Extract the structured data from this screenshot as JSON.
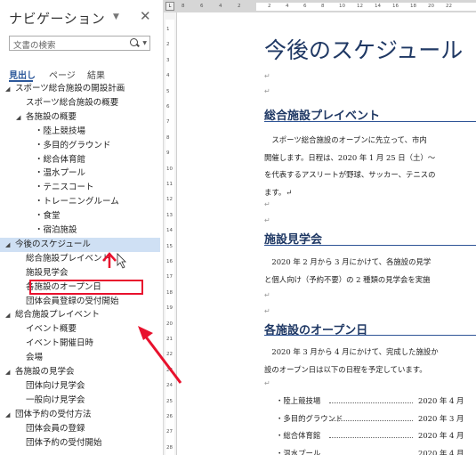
{
  "nav": {
    "title": "ナビゲーション",
    "menu_glyph": "▼",
    "close_glyph": "✕",
    "search_placeholder": "文書の検索",
    "tabs": [
      "見出し",
      "ページ",
      "結果"
    ],
    "tree": [
      {
        "label": "スポーツ総合施設の開設計画",
        "level": 1,
        "collapsible": true
      },
      {
        "label": "スポーツ総合施設の概要",
        "level": 2,
        "collapsible": false
      },
      {
        "label": "各施設の概要",
        "level": 2,
        "collapsible": true
      },
      {
        "label": "・陸上競技場",
        "level": 3,
        "collapsible": false
      },
      {
        "label": "・多目的グラウンド",
        "level": 3,
        "collapsible": false
      },
      {
        "label": "・総合体育館",
        "level": 3,
        "collapsible": false
      },
      {
        "label": "・温水プール",
        "level": 3,
        "collapsible": false
      },
      {
        "label": "・テニスコート",
        "level": 3,
        "collapsible": false
      },
      {
        "label": "・トレーニングルーム",
        "level": 3,
        "collapsible": false
      },
      {
        "label": "・食堂",
        "level": 3,
        "collapsible": false
      },
      {
        "label": "・宿泊施設",
        "level": 3,
        "collapsible": false
      },
      {
        "label": "今後のスケジュール",
        "level": 1,
        "collapsible": true,
        "selected": true
      },
      {
        "label": "総合施設プレイベント",
        "level": 2,
        "collapsible": false
      },
      {
        "label": "施設見学会",
        "level": 2,
        "collapsible": false
      },
      {
        "label": "各施設のオープン日",
        "level": 2,
        "collapsible": false,
        "highlighted": true
      },
      {
        "label": "団体会員登録の受付開始",
        "level": 2,
        "collapsible": false
      },
      {
        "label": "総合施設プレイベント",
        "level": 1,
        "collapsible": true
      },
      {
        "label": "イベント概要",
        "level": 2,
        "collapsible": false
      },
      {
        "label": "イベント開催日時",
        "level": 2,
        "collapsible": false
      },
      {
        "label": "会場",
        "level": 2,
        "collapsible": false
      },
      {
        "label": "各施設の見学会",
        "level": 1,
        "collapsible": true
      },
      {
        "label": "団体向け見学会",
        "level": 2,
        "collapsible": false
      },
      {
        "label": "一般向け見学会",
        "level": 2,
        "collapsible": false
      },
      {
        "label": "団体予約の受付方法",
        "level": 1,
        "collapsible": true
      },
      {
        "label": "団体会員の登録",
        "level": 2,
        "collapsible": false
      },
      {
        "label": "団体予約の受付開始",
        "level": 2,
        "collapsible": false
      }
    ]
  },
  "ruler": {
    "h_left": [
      "8",
      "6",
      "4",
      "2"
    ],
    "h_right": [
      "2",
      "4",
      "6",
      "8",
      "10",
      "12",
      "14",
      "16",
      "18",
      "20",
      "22"
    ],
    "v": [
      "1",
      "2",
      "3",
      "4",
      "5",
      "6",
      "7",
      "8",
      "9",
      "10",
      "11",
      "12",
      "13",
      "14",
      "15",
      "16",
      "17",
      "18",
      "19",
      "20",
      "21",
      "22",
      "23",
      "24",
      "25",
      "26",
      "27",
      "28"
    ]
  },
  "doc": {
    "title": "今後のスケジュール",
    "return_mark": "↵",
    "sections": [
      {
        "heading": "総合施設プレイベント",
        "lines": [
          "　スポーツ総合施設のオープンに先立って、市内",
          "開催します。日程は、2020 年 1 月 25 日（土）～",
          "を代表するアスリートが野球、サッカー、テニスの",
          "ます。↵"
        ]
      },
      {
        "heading": "施設見学会",
        "lines": [
          "　2020 年 2 月から 3 月にかけて、各施設の見学",
          "と個人向け（予約不要）の 2 種類の見学会を実施"
        ]
      },
      {
        "heading": "各施設のオープン日",
        "lines": [
          "　2020 年 3 月から 4 月にかけて、完成した施設か",
          "設のオープン日は以下の日程を予定しています。"
        ]
      }
    ],
    "bullets": [
      {
        "name": "・陸上競技場",
        "date": "2020 年 4 月"
      },
      {
        "name": "・多目的グラウンド",
        "date": "2020 年 3 月"
      },
      {
        "name": "・総合体育館",
        "date": "2020 年 4 月"
      },
      {
        "name": "・温水プール",
        "date": "2020 年 4 月"
      }
    ]
  },
  "colors": {
    "heading": "#1f3864",
    "tab_accent": "#2b579a",
    "selection": "#cfe0f4",
    "annotation": "#e8112d"
  }
}
